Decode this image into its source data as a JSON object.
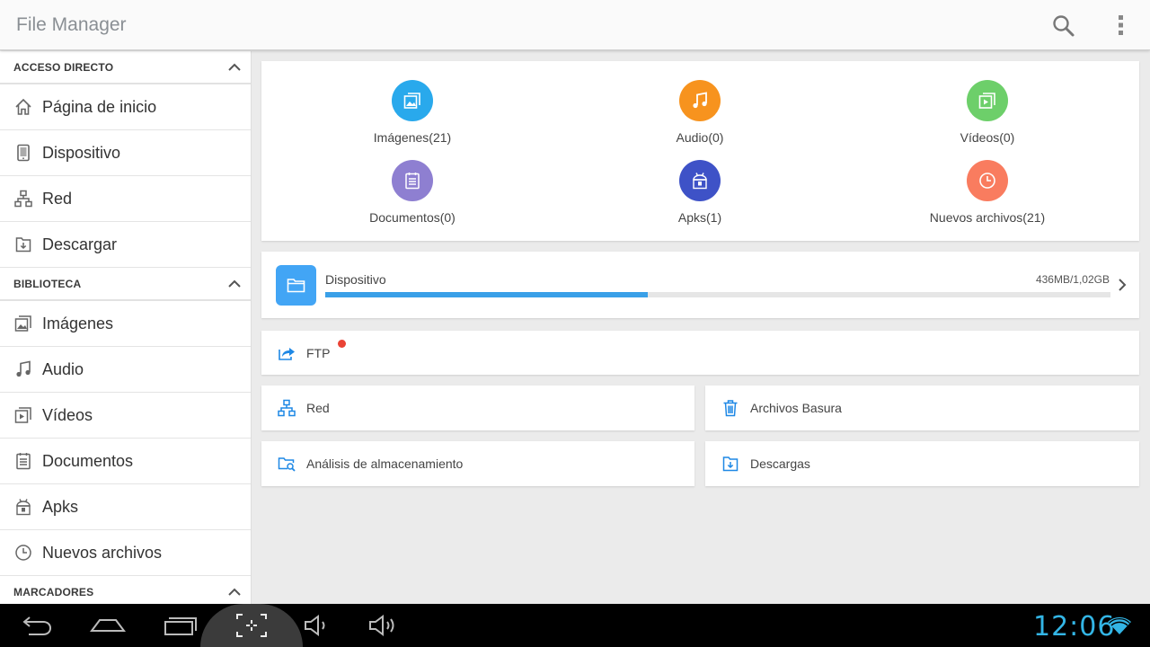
{
  "app": {
    "title": "File Manager"
  },
  "colors": {
    "accent": "#33b5e5",
    "images": "#29a9ec",
    "audio": "#f7931e",
    "videos": "#6dcf6a",
    "documents": "#8e7fd1",
    "apks": "#3e52c7",
    "recent": "#f97c5f",
    "device_folder": "#42a5f5",
    "ftp_dot": "#ea4335"
  },
  "sidebar": {
    "sections": [
      {
        "title": "ACCESO DIRECTO",
        "items": [
          {
            "label": "Página de inicio",
            "icon": "home-icon"
          },
          {
            "label": "Dispositivo",
            "icon": "device-icon"
          },
          {
            "label": "Red",
            "icon": "network-icon"
          },
          {
            "label": "Descargar",
            "icon": "download-icon"
          }
        ]
      },
      {
        "title": "BIBLIOTECA",
        "items": [
          {
            "label": "Imágenes",
            "icon": "images-icon"
          },
          {
            "label": "Audio",
            "icon": "music-icon"
          },
          {
            "label": "Vídeos",
            "icon": "video-icon"
          },
          {
            "label": "Documentos",
            "icon": "document-icon"
          },
          {
            "label": "Apks",
            "icon": "android-icon"
          },
          {
            "label": "Nuevos archivos",
            "icon": "clock-icon"
          }
        ]
      },
      {
        "title": "MARCADORES",
        "items": []
      }
    ]
  },
  "categories": [
    {
      "label": "Imágenes(21)",
      "icon": "images-icon"
    },
    {
      "label": "Audio(0)",
      "icon": "music-icon"
    },
    {
      "label": "Vídeos(0)",
      "icon": "video-icon"
    },
    {
      "label": "Documentos(0)",
      "icon": "document-icon"
    },
    {
      "label": "Apks(1)",
      "icon": "android-icon"
    },
    {
      "label": "Nuevos archivos(21)",
      "icon": "clock-icon"
    }
  ],
  "device": {
    "name": "Dispositivo",
    "usage": "436MB/1,02GB",
    "used_fraction": 0.411
  },
  "ftp": {
    "label": "FTP"
  },
  "tools": {
    "network": "Red",
    "trash": "Archivos Basura",
    "storage_analysis": "Análisis de almacenamiento",
    "downloads": "Descargas"
  },
  "status": {
    "time": "12:06"
  }
}
